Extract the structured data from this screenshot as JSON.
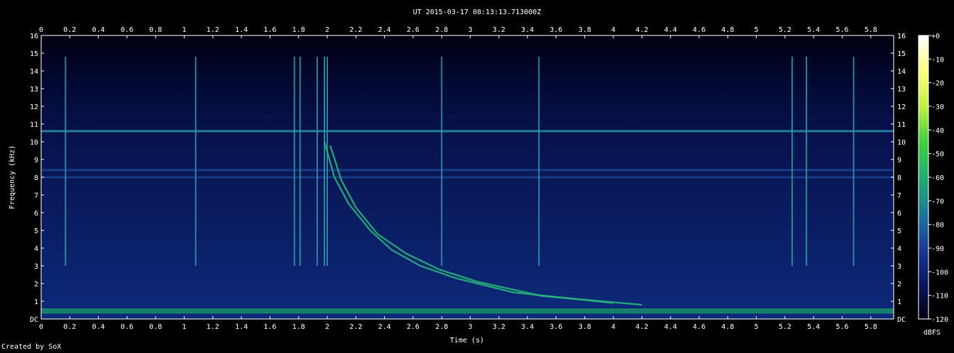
{
  "title": "UT 2015-03-17 08:13:13.713000Z",
  "credit": "Created by SoX",
  "colorbar_label": "dBFS",
  "colors": {
    "background": "#000000",
    "axis": "#ffffff",
    "colormap": [
      "#000010",
      "#0a1660",
      "#1a3a9a",
      "#1c7a9a",
      "#20b070",
      "#40d040",
      "#c0f040",
      "#ffff80",
      "#ffffff"
    ]
  },
  "chart_data": {
    "type": "heatmap",
    "title": "UT 2015-03-17 08:13:13.713000Z",
    "xlabel": "Time (s)",
    "ylabel": "Frequency (kHz)",
    "xlim": [
      0,
      5.96
    ],
    "ylim": [
      0,
      16
    ],
    "x_ticks": [
      "0",
      "0.2",
      "0.4",
      "0.6",
      "0.8",
      "1",
      "1.2",
      "1.4",
      "1.6",
      "1.8",
      "2",
      "2.2",
      "2.4",
      "2.6",
      "2.8",
      "3",
      "3.2",
      "3.4",
      "3.6",
      "3.8",
      "4",
      "4.2",
      "4.4",
      "4.6",
      "4.8",
      "5",
      "5.2",
      "5.4",
      "5.6",
      "5.8"
    ],
    "y_ticks": [
      "DC",
      "1",
      "2",
      "3",
      "4",
      "5",
      "6",
      "7",
      "8",
      "9",
      "10",
      "11",
      "12",
      "13",
      "14",
      "15",
      "16"
    ],
    "colorbar_ticks": [
      "+0",
      "-10",
      "-20",
      "-30",
      "-40",
      "-50",
      "-60",
      "-70",
      "-80",
      "-90",
      "-100",
      "-110",
      "-120"
    ],
    "colorbar_range": [
      -120,
      0
    ],
    "colorbar_unit": "dBFS",
    "features": {
      "tone_khz": [
        10.6,
        8.4,
        8.0
      ],
      "low_band_khz": [
        0.3,
        0.6
      ],
      "impulses_s": [
        0.17,
        1.08,
        1.77,
        1.81,
        1.93,
        1.98,
        2.0,
        2.8,
        3.48,
        5.25,
        5.35,
        5.68
      ],
      "whistler_curves": [
        [
          [
            1.98,
            10.0
          ],
          [
            2.05,
            8.0
          ],
          [
            2.15,
            6.5
          ],
          [
            2.3,
            5.0
          ],
          [
            2.45,
            3.9
          ],
          [
            2.65,
            3.0
          ],
          [
            2.9,
            2.3
          ],
          [
            3.3,
            1.5
          ],
          [
            4.0,
            0.9
          ]
        ],
        [
          [
            2.02,
            9.8
          ],
          [
            2.1,
            7.8
          ],
          [
            2.2,
            6.3
          ],
          [
            2.35,
            4.8
          ],
          [
            2.55,
            3.7
          ],
          [
            2.78,
            2.8
          ],
          [
            3.05,
            2.1
          ],
          [
            3.5,
            1.3
          ],
          [
            4.2,
            0.8
          ]
        ]
      ]
    }
  }
}
